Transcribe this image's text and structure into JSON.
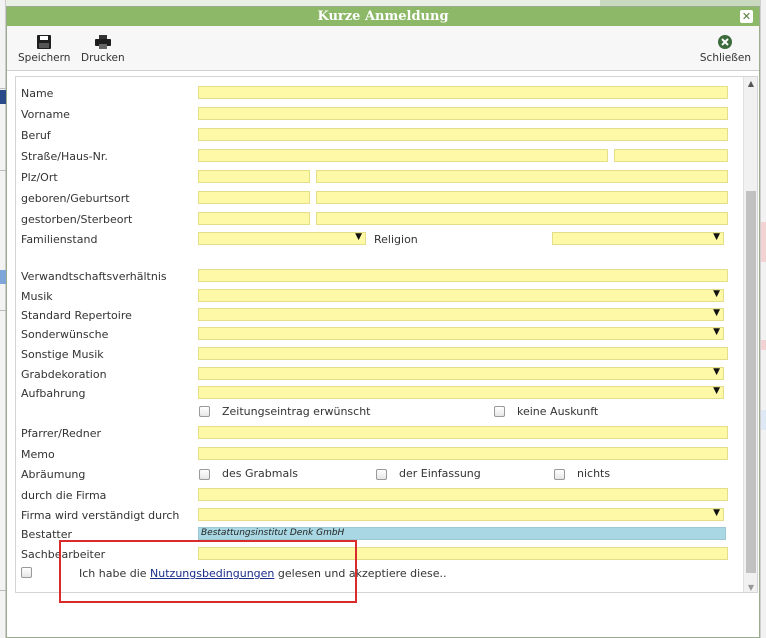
{
  "dialog": {
    "title": "Kurze Anmeldung",
    "close_glyph": "✕"
  },
  "toolbar": {
    "save_label": "Speichern",
    "save_icon": "floppy-disk-icon",
    "print_label": "Drucken",
    "print_icon": "printer-icon",
    "close_label": "Schließen",
    "close_icon": "close-circle-icon"
  },
  "form": {
    "name_label": "Name",
    "vorname_label": "Vorname",
    "beruf_label": "Beruf",
    "strasse_label": "Straße/Haus-Nr.",
    "plz_label": "Plz/Ort",
    "geboren_label": "geboren/Geburtsort",
    "gestorben_label": "gestorben/Sterbeort",
    "familienstand_label": "Familienstand",
    "religion_label": "Religion",
    "verwandtschaft_label": "Verwandtschaftsverhältnis",
    "musik_label": "Musik",
    "repertoire_label": "Standard Repertoire",
    "sonderwuensche_label": "Sonderwünsche",
    "sonstige_musik_label": "Sonstige Musik",
    "grabdekoration_label": "Grabdekoration",
    "aufbahrung_label": "Aufbahrung",
    "zeitung_label": "Zeitungseintrag erwünscht",
    "keine_auskunft_label": "keine Auskunft",
    "pfarrer_label": "Pfarrer/Redner",
    "memo_label": "Memo",
    "abraeumung_label": "Abräumung",
    "grabmal_label": "des Grabmals",
    "einfassung_label": "der Einfassung",
    "nichts_label": "nichts",
    "firma_label": "durch die Firma",
    "firma_verstaendigt_label": "Firma wird verständigt durch",
    "bestatter_label": "Bestatter",
    "bestatter_value": "Bestattungsinstitut Denk GmbH",
    "sachbearbeiter_label": "Sachbearbeiter",
    "terms_prefix": "Ich habe die ",
    "terms_link": "Nutzungsbedingungen",
    "terms_suffix": " gelesen und akzeptiere diese.."
  },
  "colors": {
    "title_bar": "#8cb868",
    "field_fill": "#fdf9a6",
    "bestatter_fill": "#a9d8e4",
    "highlight_box": "#d92b2b"
  }
}
